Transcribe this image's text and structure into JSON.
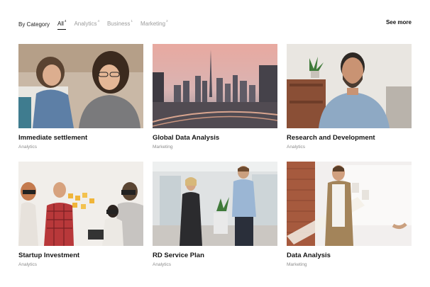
{
  "filters": {
    "label": "By Category",
    "items": [
      {
        "label": "All",
        "count": "4",
        "active": true
      },
      {
        "label": "Analytics",
        "count": "4",
        "active": false
      },
      {
        "label": "Business",
        "count": "1",
        "active": false
      },
      {
        "label": "Marketing",
        "count": "2",
        "active": false
      }
    ],
    "see_more": "See more"
  },
  "cards": [
    {
      "title": "Immediate settlement",
      "category": "Analytics",
      "image": "two-women-at-laptop-photo"
    },
    {
      "title": "Global Data Analysis",
      "category": "Marketing",
      "image": "city-skyline-at-sunset-photo"
    },
    {
      "title": "Research and Development",
      "category": "Analytics",
      "image": "smiling-bearded-man-in-office-photo"
    },
    {
      "title": "Startup Investment",
      "category": "Analytics",
      "image": "team-with-vr-headsets-photo"
    },
    {
      "title": "RD Service Plan",
      "category": "Analytics",
      "image": "business-people-in-office-photo"
    },
    {
      "title": "Data Analysis",
      "category": "Marketing",
      "image": "man-presenting-at-whiteboard-photo"
    }
  ]
}
